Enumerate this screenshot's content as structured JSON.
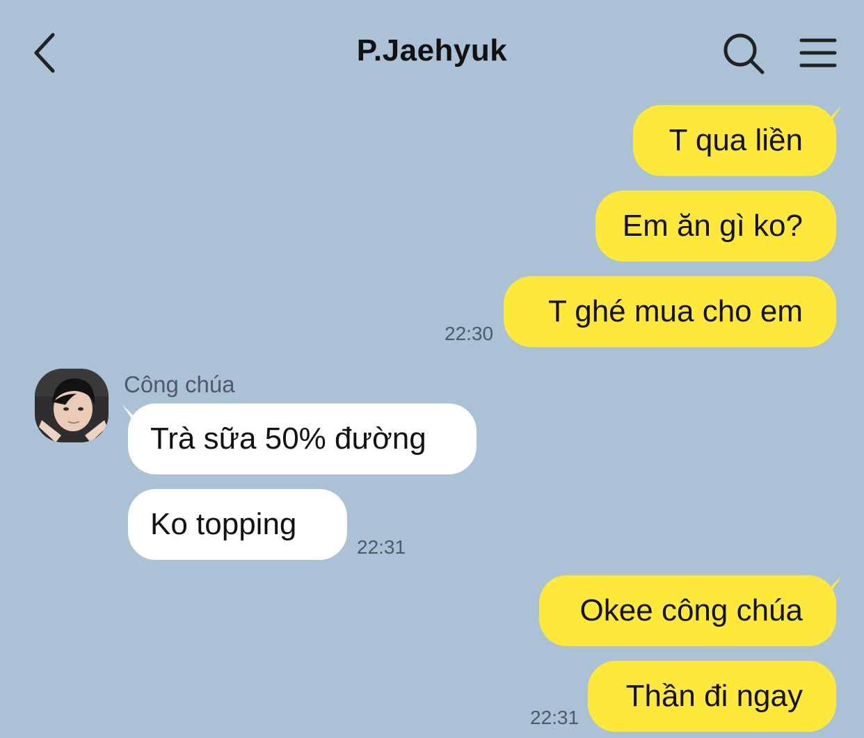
{
  "header": {
    "title": "P.Jaehyuk",
    "back_icon": "chevron-left-icon",
    "search_icon": "search-icon",
    "menu_icon": "menu-icon"
  },
  "messages": {
    "m1": "T qua liền",
    "m2": "Em ăn gì ko?",
    "m3": "T ghé mua cho em",
    "time1": "22:30",
    "sender": "Công chúa",
    "m4": "Trà sữa 50% đường",
    "m5": "Ko topping",
    "time2": "22:31",
    "m6": "Okee công chúa",
    "m7": "Thần đi ngay",
    "time3": "22:31"
  },
  "colors": {
    "background": "#abc1d6",
    "outgoing_bubble": "#fee93a",
    "incoming_bubble": "#ffffff"
  }
}
